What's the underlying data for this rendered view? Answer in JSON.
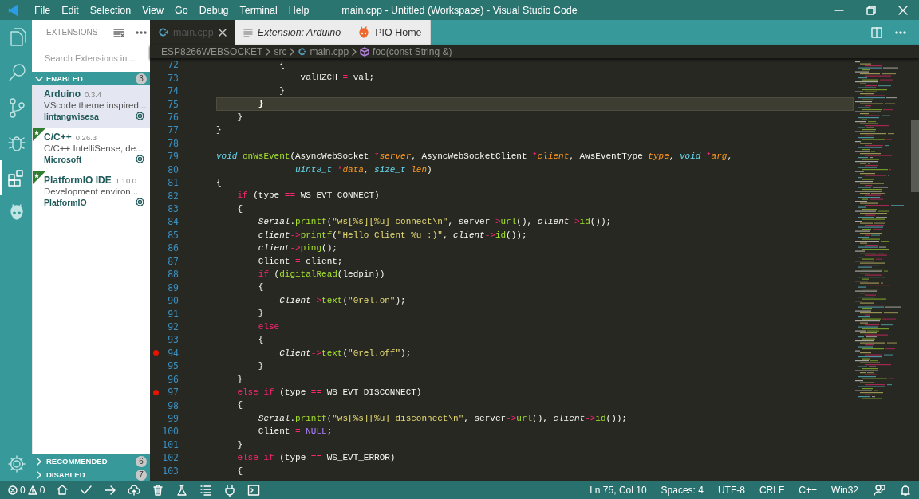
{
  "window": {
    "title": "main.cpp - Untitled (Workspace) - Visual Studio Code"
  },
  "menu": [
    "File",
    "Edit",
    "Selection",
    "View",
    "Go",
    "Debug",
    "Terminal",
    "Help"
  ],
  "activity_bar": [
    {
      "kind": "files",
      "selected": false
    },
    {
      "kind": "search",
      "selected": false
    },
    {
      "kind": "scm",
      "selected": false
    },
    {
      "kind": "debug",
      "selected": false
    },
    {
      "kind": "extensions",
      "selected": true
    },
    {
      "kind": "alien",
      "selected": false
    }
  ],
  "sidebar": {
    "title": "EXTENSIONS",
    "search": {
      "placeholder": "Search Extensions in ..."
    },
    "sections": [
      {
        "label": "ENABLED",
        "count": "3",
        "expanded": true,
        "items": [
          {
            "name": "Arduino",
            "version": "0.3.4",
            "description": "VScode theme inspired...",
            "publisher": "lintangwisesa",
            "selected": true,
            "recommended": false
          },
          {
            "name": "C/C++",
            "version": "0.26.3",
            "description": "C/C++ IntelliSense, de...",
            "publisher": "Microsoft",
            "selected": false,
            "recommended": true
          },
          {
            "name": "PlatformIO IDE",
            "version": "1.10.0",
            "description": "Development environ...",
            "publisher": "PlatformIO",
            "selected": false,
            "recommended": true
          }
        ]
      },
      {
        "label": "RECOMMENDED",
        "count": "6",
        "expanded": false
      },
      {
        "label": "DISABLED",
        "count": "7",
        "expanded": false
      }
    ]
  },
  "tabs": [
    {
      "label": "main.cpp",
      "kind": "file",
      "selected": true,
      "italic": false
    },
    {
      "label": "Extension: Arduino",
      "kind": "extension",
      "selected": false,
      "italic": true
    },
    {
      "label": "PIO Home",
      "kind": "pio",
      "selected": false,
      "italic": false
    }
  ],
  "breadcrumb": [
    {
      "label": "ESP8266WEBSOCKET",
      "kind": "folder"
    },
    {
      "label": "src",
      "kind": "folder"
    },
    {
      "label": "main.cpp",
      "kind": "file"
    },
    {
      "label": "foo(const String &)",
      "kind": "symbol"
    }
  ],
  "lines": [
    {
      "number": "72",
      "current": false,
      "breakpoint": false,
      "tokens": [
        {
          "kind": "plain",
          "text": "            {"
        }
      ]
    },
    {
      "number": "73",
      "current": false,
      "breakpoint": false,
      "tokens": [
        {
          "kind": "plain",
          "text": "                valHZCH"
        },
        {
          "kind": "kw",
          "text": " ="
        },
        {
          "kind": "plain",
          "text": " val;"
        }
      ]
    },
    {
      "number": "74",
      "current": false,
      "breakpoint": false,
      "tokens": [
        {
          "kind": "plain",
          "text": "            }"
        }
      ]
    },
    {
      "number": "75",
      "current": true,
      "breakpoint": false,
      "tokens": [
        {
          "kind": "plain",
          "text": "        }"
        }
      ]
    },
    {
      "number": "76",
      "current": false,
      "breakpoint": false,
      "tokens": [
        {
          "kind": "plain",
          "text": "    }"
        }
      ]
    },
    {
      "number": "77",
      "current": false,
      "breakpoint": false,
      "tokens": [
        {
          "kind": "plain",
          "text": "}"
        }
      ]
    },
    {
      "number": "78",
      "current": false,
      "breakpoint": false
    },
    {
      "number": "79",
      "current": false,
      "breakpoint": false,
      "tokens": [
        {
          "kind": "type",
          "text": "void"
        },
        {
          "kind": "fn",
          "text": " onWsEvent"
        },
        {
          "kind": "plain",
          "text": "(AsyncWebSocket"
        },
        {
          "kind": "kw",
          "text": " *"
        },
        {
          "kind": "param",
          "text": "server"
        },
        {
          "kind": "plain",
          "text": ", AsyncWebSocketClient"
        },
        {
          "kind": "kw",
          "text": " *"
        },
        {
          "kind": "param",
          "text": "client"
        },
        {
          "kind": "plain",
          "text": ", AwsEventType"
        },
        {
          "kind": "param",
          "text": " type"
        },
        {
          "kind": "plain",
          "text": ","
        },
        {
          "kind": "type",
          "text": " void"
        },
        {
          "kind": "kw",
          "text": " *"
        },
        {
          "kind": "param",
          "text": "arg"
        },
        {
          "kind": "plain",
          "text": ","
        }
      ]
    },
    {
      "number": "80",
      "current": false,
      "breakpoint": false,
      "tokens": [
        {
          "kind": "type",
          "text": "               uint8_t"
        },
        {
          "kind": "kw",
          "text": " *"
        },
        {
          "kind": "param",
          "text": "data"
        },
        {
          "kind": "plain",
          "text": ","
        },
        {
          "kind": "type",
          "text": " size_t"
        },
        {
          "kind": "param",
          "text": " len"
        },
        {
          "kind": "plain",
          "text": ")"
        }
      ]
    },
    {
      "number": "81",
      "current": false,
      "breakpoint": false,
      "tokens": [
        {
          "kind": "plain",
          "text": "{"
        }
      ]
    },
    {
      "number": "82",
      "current": false,
      "breakpoint": false,
      "tokens": [
        {
          "kind": "kw",
          "text": "    if"
        },
        {
          "kind": "plain",
          "text": " (type"
        },
        {
          "kind": "kw",
          "text": " =="
        },
        {
          "kind": "plain",
          "text": " WS_EVT_CONNECT)"
        }
      ]
    },
    {
      "number": "83",
      "current": false,
      "breakpoint": false,
      "tokens": [
        {
          "kind": "plain",
          "text": "    {"
        }
      ]
    },
    {
      "number": "84",
      "current": false,
      "breakpoint": false,
      "tokens": [
        {
          "kind": "var",
          "text": "        Serial"
        },
        {
          "kind": "plain",
          "text": "."
        },
        {
          "kind": "fn",
          "text": "printf"
        },
        {
          "kind": "plain",
          "text": "("
        },
        {
          "kind": "str",
          "text": "\"ws[%s][%u] connect\\n\""
        },
        {
          "kind": "plain",
          "text": ", server"
        },
        {
          "kind": "kw",
          "text": "->"
        },
        {
          "kind": "fn",
          "text": "url"
        },
        {
          "kind": "plain",
          "text": "(),"
        },
        {
          "kind": "var",
          "text": " client"
        },
        {
          "kind": "kw",
          "text": "->"
        },
        {
          "kind": "fn",
          "text": "id"
        },
        {
          "kind": "plain",
          "text": "());"
        }
      ]
    },
    {
      "number": "85",
      "current": false,
      "breakpoint": false,
      "tokens": [
        {
          "kind": "var",
          "text": "        client"
        },
        {
          "kind": "kw",
          "text": "->"
        },
        {
          "kind": "fn",
          "text": "printf"
        },
        {
          "kind": "plain",
          "text": "("
        },
        {
          "kind": "str",
          "text": "\"Hello Client %u :)\""
        },
        {
          "kind": "plain",
          "text": ","
        },
        {
          "kind": "var",
          "text": " client"
        },
        {
          "kind": "kw",
          "text": "->"
        },
        {
          "kind": "fn",
          "text": "id"
        },
        {
          "kind": "plain",
          "text": "());"
        }
      ]
    },
    {
      "number": "86",
      "current": false,
      "breakpoint": false,
      "tokens": [
        {
          "kind": "var",
          "text": "        client"
        },
        {
          "kind": "kw",
          "text": "->"
        },
        {
          "kind": "fn",
          "text": "ping"
        },
        {
          "kind": "plain",
          "text": "();"
        }
      ]
    },
    {
      "number": "87",
      "current": false,
      "breakpoint": false,
      "tokens": [
        {
          "kind": "plain",
          "text": "        Client"
        },
        {
          "kind": "kw",
          "text": " ="
        },
        {
          "kind": "plain",
          "text": " client;"
        }
      ]
    },
    {
      "number": "88",
      "current": false,
      "breakpoint": false,
      "tokens": [
        {
          "kind": "kw",
          "text": "        if"
        },
        {
          "kind": "plain",
          "text": " ("
        },
        {
          "kind": "fn",
          "text": "digitalRead"
        },
        {
          "kind": "plain",
          "text": "(ledpin))"
        }
      ]
    },
    {
      "number": "89",
      "current": false,
      "breakpoint": false,
      "tokens": [
        {
          "kind": "plain",
          "text": "        {"
        }
      ]
    },
    {
      "number": "90",
      "current": false,
      "breakpoint": false,
      "tokens": [
        {
          "kind": "var",
          "text": "            Client"
        },
        {
          "kind": "kw",
          "text": "->"
        },
        {
          "kind": "fn",
          "text": "text"
        },
        {
          "kind": "plain",
          "text": "("
        },
        {
          "kind": "str",
          "text": "\"0rel.on\""
        },
        {
          "kind": "plain",
          "text": ");"
        }
      ]
    },
    {
      "number": "91",
      "current": false,
      "breakpoint": false,
      "tokens": [
        {
          "kind": "plain",
          "text": "        }"
        }
      ]
    },
    {
      "number": "92",
      "current": false,
      "breakpoint": false,
      "tokens": [
        {
          "kind": "kw",
          "text": "        else"
        }
      ]
    },
    {
      "number": "93",
      "current": false,
      "breakpoint": false,
      "tokens": [
        {
          "kind": "plain",
          "text": "        {"
        }
      ]
    },
    {
      "number": "94",
      "current": false,
      "breakpoint": true,
      "tokens": [
        {
          "kind": "var",
          "text": "            Client"
        },
        {
          "kind": "kw",
          "text": "->"
        },
        {
          "kind": "fn",
          "text": "text"
        },
        {
          "kind": "plain",
          "text": "("
        },
        {
          "kind": "str",
          "text": "\"0rel.off\""
        },
        {
          "kind": "plain",
          "text": ");"
        }
      ]
    },
    {
      "number": "95",
      "current": false,
      "breakpoint": false,
      "tokens": [
        {
          "kind": "plain",
          "text": "        }"
        }
      ]
    },
    {
      "number": "96",
      "current": false,
      "breakpoint": false,
      "tokens": [
        {
          "kind": "plain",
          "text": "    }"
        }
      ]
    },
    {
      "number": "97",
      "current": false,
      "breakpoint": true,
      "tokens": [
        {
          "kind": "kw",
          "text": "    else if"
        },
        {
          "kind": "plain",
          "text": " (type"
        },
        {
          "kind": "kw",
          "text": " =="
        },
        {
          "kind": "plain",
          "text": " WS_EVT_DISCONNECT)"
        }
      ]
    },
    {
      "number": "98",
      "current": false,
      "breakpoint": false,
      "tokens": [
        {
          "kind": "plain",
          "text": "    {"
        }
      ]
    },
    {
      "number": "99",
      "current": false,
      "breakpoint": false,
      "tokens": [
        {
          "kind": "var",
          "text": "        Serial"
        },
        {
          "kind": "plain",
          "text": "."
        },
        {
          "kind": "fn",
          "text": "printf"
        },
        {
          "kind": "plain",
          "text": "("
        },
        {
          "kind": "str",
          "text": "\"ws[%s][%u] disconnect\\n\""
        },
        {
          "kind": "plain",
          "text": ", server"
        },
        {
          "kind": "kw",
          "text": "->"
        },
        {
          "kind": "fn",
          "text": "url"
        },
        {
          "kind": "plain",
          "text": "(),"
        },
        {
          "kind": "var",
          "text": " client"
        },
        {
          "kind": "kw",
          "text": "->"
        },
        {
          "kind": "fn",
          "text": "id"
        },
        {
          "kind": "plain",
          "text": "());"
        }
      ]
    },
    {
      "number": "100",
      "current": false,
      "breakpoint": false,
      "tokens": [
        {
          "kind": "plain",
          "text": "        Client"
        },
        {
          "kind": "kw",
          "text": " ="
        },
        {
          "kind": "const",
          "text": " NULL"
        },
        {
          "kind": "plain",
          "text": ";"
        }
      ]
    },
    {
      "number": "101",
      "current": false,
      "breakpoint": false,
      "tokens": [
        {
          "kind": "plain",
          "text": "    }"
        }
      ]
    },
    {
      "number": "102",
      "current": false,
      "breakpoint": false,
      "tokens": [
        {
          "kind": "kw",
          "text": "    else if"
        },
        {
          "kind": "plain",
          "text": " (type"
        },
        {
          "kind": "kw",
          "text": " =="
        },
        {
          "kind": "plain",
          "text": " WS_EVT_ERROR)"
        }
      ]
    },
    {
      "number": "103",
      "current": false,
      "breakpoint": false,
      "tokens": [
        {
          "kind": "plain",
          "text": "    {"
        }
      ]
    }
  ],
  "status_bar": {
    "errors": "0",
    "warnings": "0",
    "tools": [
      {
        "kind": "home"
      },
      {
        "kind": "check"
      },
      {
        "kind": "arrow"
      },
      {
        "kind": "cloud"
      },
      {
        "kind": "trash"
      },
      {
        "kind": "flask"
      },
      {
        "kind": "list"
      },
      {
        "kind": "plug"
      },
      {
        "kind": "terminal"
      }
    ],
    "right": [
      "Ln 75, Col 10",
      "Spaces: 4",
      "UTF-8",
      "CRLF",
      "C++",
      "Win32"
    ]
  }
}
